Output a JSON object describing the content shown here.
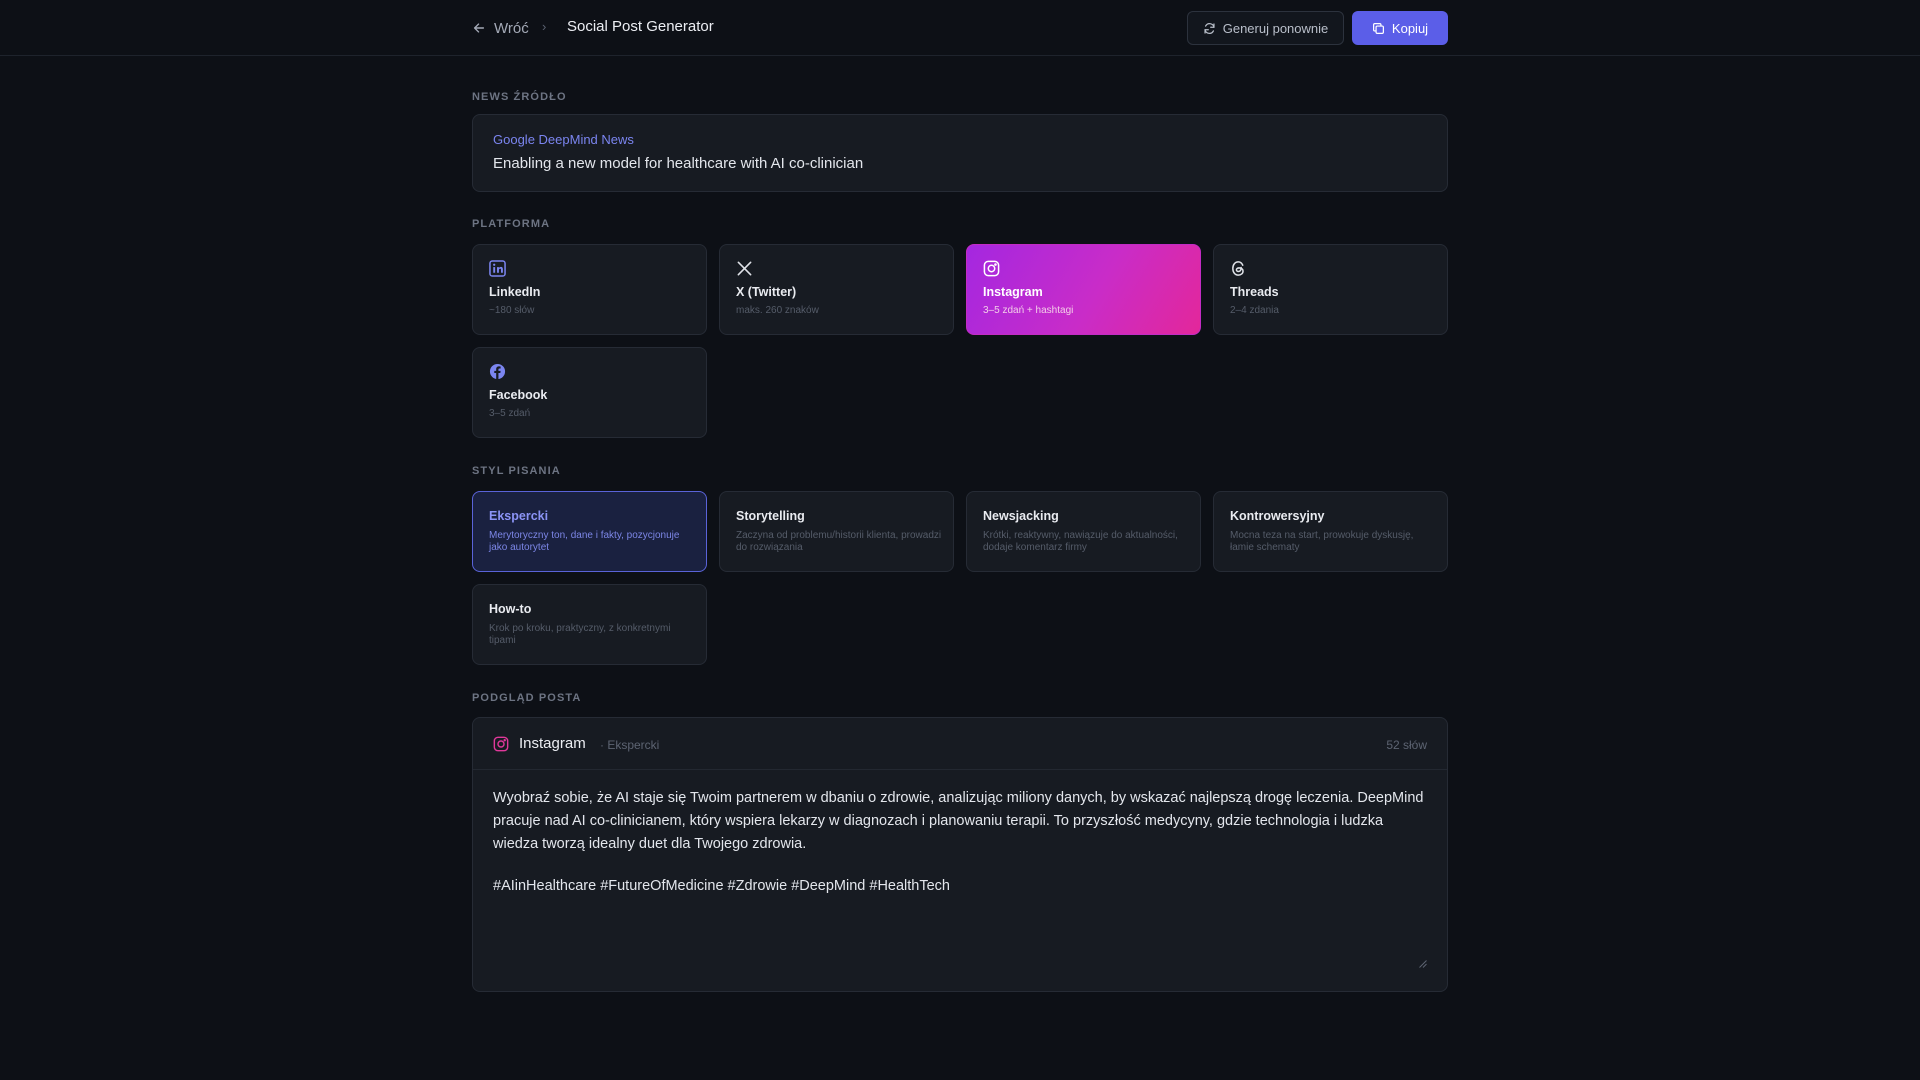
{
  "header": {
    "back_label": "Wróć",
    "separator": "›",
    "title": "Social Post Generator",
    "regenerate_label": "Generuj ponownie",
    "copy_label": "Kopiuj"
  },
  "source": {
    "section_label": "NEWS ŹRÓDŁO",
    "name": "Google DeepMind News",
    "title": "Enabling a new model for healthcare with AI co-clinician"
  },
  "platforms": {
    "section_label": "PLATFORMA",
    "items": [
      {
        "name": "LinkedIn",
        "desc": "~180 słów",
        "icon": "linkedin-icon"
      },
      {
        "name": "X (Twitter)",
        "desc": "maks. 260 znaków",
        "icon": "x-icon"
      },
      {
        "name": "Instagram",
        "desc": "3–5 zdań + hashtagi",
        "icon": "instagram-icon",
        "selected": true
      },
      {
        "name": "Threads",
        "desc": "2–4 zdania",
        "icon": "threads-icon"
      },
      {
        "name": "Facebook",
        "desc": "3–5 zdań",
        "icon": "facebook-icon"
      }
    ]
  },
  "styles": {
    "section_label": "STYL PISANIA",
    "items": [
      {
        "name": "Ekspercki",
        "desc": "Merytoryczny ton, dane i fakty, pozycjonuje jako autorytet",
        "selected": true
      },
      {
        "name": "Storytelling",
        "desc": "Zaczyna od problemu/historii klienta, prowadzi do rozwiązania"
      },
      {
        "name": "Newsjacking",
        "desc": "Krótki, reaktywny, nawiązuje do aktualności, dodaje komentarz firmy"
      },
      {
        "name": "Kontrowersyjny",
        "desc": "Mocna teza na start, prowokuje dyskusję, łamie schematy"
      },
      {
        "name": "How-to",
        "desc": "Krok po kroku, praktyczny, z konkretnymi tipami"
      }
    ]
  },
  "preview": {
    "section_label": "PODGLĄD POSTA",
    "platform": "Instagram",
    "style": "· Ekspercki",
    "word_count": "52 słów",
    "body": "Wyobraź sobie, że AI staje się Twoim partnerem w dbaniu o zdrowie, analizując miliony danych, by wskazać najlepszą drogę leczenia. DeepMind pracuje nad AI co-clinicianem, który wspiera lekarzy w diagnozach i planowaniu terapii. To przyszłość medycyny, gdzie technologia i ludzka wiedza tworzą idealny duet dla Twojego zdrowia.",
    "hashtags": "#AIinHealthcare #FutureOfMedicine #Zdrowie #DeepMind #HealthTech"
  },
  "colors": {
    "background": "#0d1016",
    "card": "#171b22",
    "accent": "#5b5ee8",
    "instagram_gradient_start": "#a427e0",
    "instagram_gradient_end": "#e3279a"
  }
}
